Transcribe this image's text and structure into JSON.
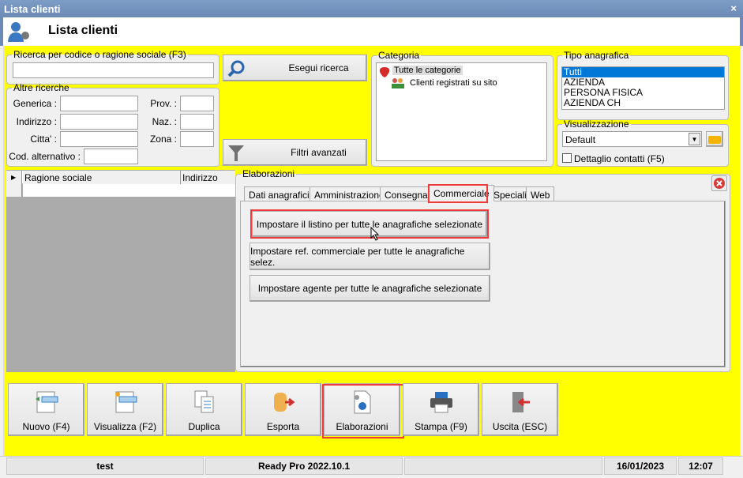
{
  "window": {
    "title": "Lista clienti",
    "close": "×"
  },
  "header": {
    "title": "Lista clienti"
  },
  "search": {
    "legend": "Ricerca per codice o ragione sociale (F3)",
    "value": "",
    "run_label": "Esegui ricerca",
    "filters_label": "Filtri avanzati"
  },
  "other": {
    "legend": "Altre ricerche",
    "generica": "Generica :",
    "indirizzo": "Indirizzo :",
    "citta": "Citta' :",
    "cod_alt": "Cod. alternativo :",
    "prov": "Prov. :",
    "naz": "Naz. :",
    "zona": "Zona :"
  },
  "categoria": {
    "legend": "Categoria",
    "root": "Tutte le categorie",
    "child": "Clienti registrati su sito"
  },
  "tipo": {
    "legend": "Tipo anagrafica",
    "items": [
      "Tutti",
      "AZIENDA",
      "PERSONA FISICA",
      "AZIENDA CH"
    ]
  },
  "vis": {
    "legend": "Visualizzazione",
    "value": "Default",
    "checkbox": "Dettaglio contatti (F5)"
  },
  "grid": {
    "columns": [
      "Ragione sociale",
      "Indirizzo"
    ]
  },
  "elab": {
    "legend": "Elaborazioni",
    "tabs": [
      "Dati anagrafici",
      "Amministrazione",
      "Consegna",
      "Commerciale",
      "Speciali",
      "Web"
    ],
    "actions": [
      "Impostare il listino per tutte le anagrafiche selezionate",
      "Impostare ref. commerciale per tutte le anagrafiche selez.",
      "Impostare agente per tutte le anagrafiche selezionate"
    ]
  },
  "toolbar": [
    "Nuovo (F4)",
    "Visualizza (F2)",
    "Duplica",
    "Esporta",
    "Elaborazioni",
    "Stampa (F9)",
    "Uscita (ESC)"
  ],
  "status": {
    "user": "test",
    "version": "Ready Pro 2022.10.1",
    "extra": "",
    "date": "16/01/2023",
    "time": "12:07"
  },
  "colors": {
    "highlight": "#ef3b3b",
    "background": "#ffff00",
    "selection": "#0078d7"
  }
}
